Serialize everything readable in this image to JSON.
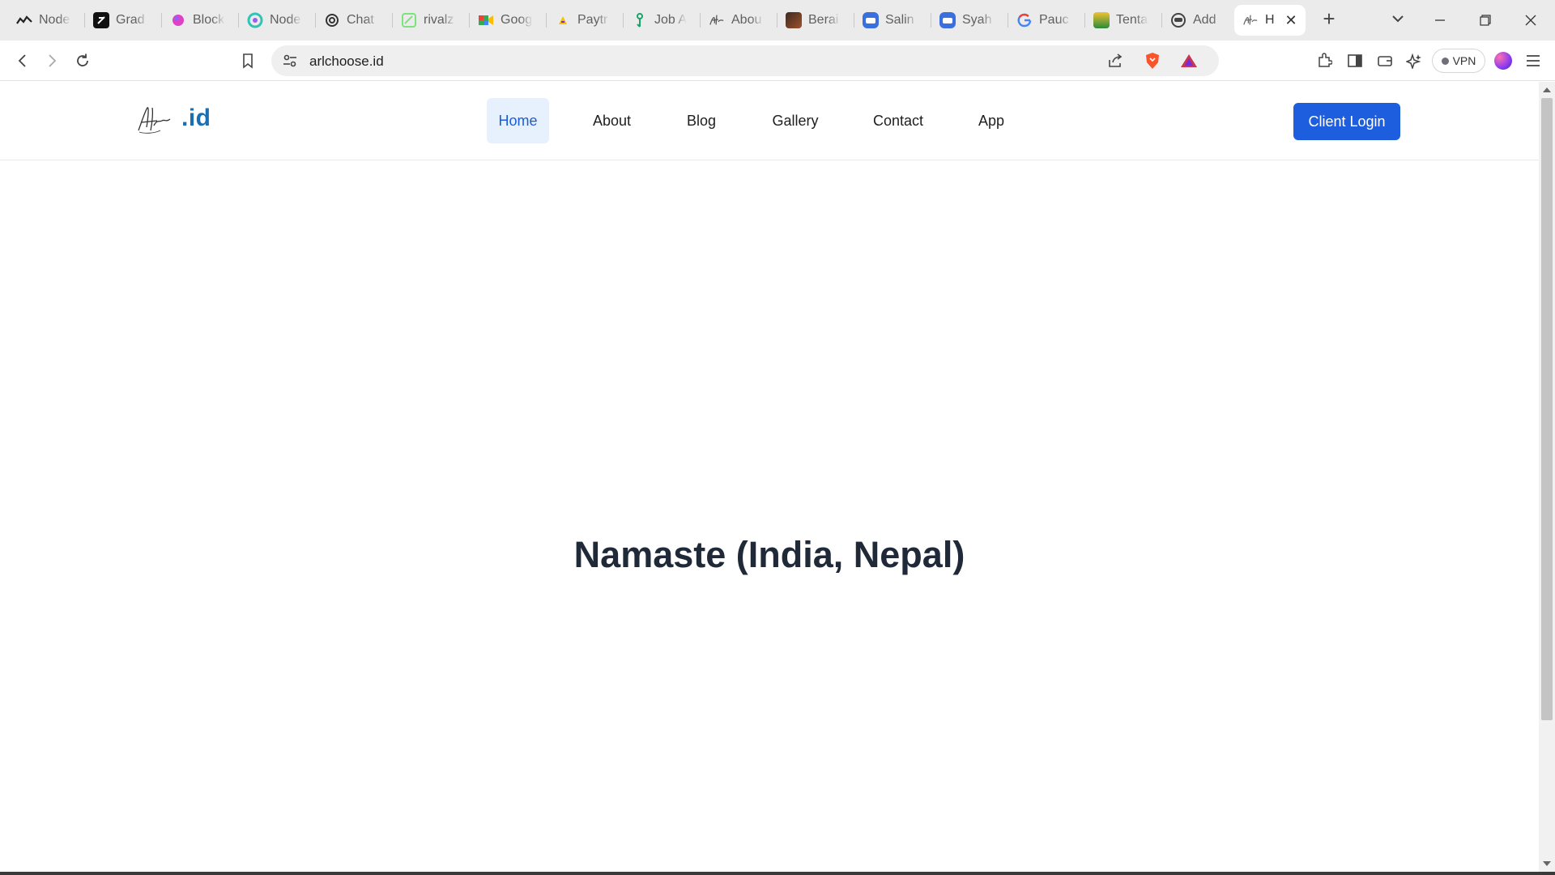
{
  "browser": {
    "tabs": [
      {
        "label": "Node",
        "icon": "node-icon",
        "color": "#222222"
      },
      {
        "label": "Grad",
        "icon": "grad-icon",
        "color": "#111111"
      },
      {
        "label": "Block",
        "icon": "block-icon",
        "color": "#e040c8"
      },
      {
        "label": "Node",
        "icon": "node-icon",
        "color": "#2ec4b6"
      },
      {
        "label": "Chat",
        "icon": "chatgpt-icon",
        "color": "#333333"
      },
      {
        "label": "rivalz",
        "icon": "rivalz-icon",
        "color": "#7be37b"
      },
      {
        "label": "Goog",
        "icon": "google-meet-icon",
        "color": "#fbbc04"
      },
      {
        "label": "Paytr",
        "icon": "paytr-icon",
        "color": "#f5c400"
      },
      {
        "label": "Job A",
        "icon": "job-icon",
        "color": "#1aa36b"
      },
      {
        "label": "Abou",
        "icon": "signature-icon",
        "color": "#555555"
      },
      {
        "label": "Berai",
        "icon": "berai-icon",
        "color": "#6b3d2a"
      },
      {
        "label": "Salin",
        "icon": "salin-icon",
        "color": "#3a6fe0"
      },
      {
        "label": "Syah",
        "icon": "syah-icon",
        "color": "#3a6fe0"
      },
      {
        "label": "Pauc",
        "icon": "google-icon",
        "color": "#4285f4"
      },
      {
        "label": "Tenta",
        "icon": "tenta-icon",
        "color": "#2a8a3a"
      },
      {
        "label": "Add",
        "icon": "add-icon",
        "color": "#444444"
      }
    ],
    "active_tab": {
      "label": "H",
      "icon": "signature-icon"
    },
    "url": "arlchoose.id",
    "vpn_label": "VPN"
  },
  "site": {
    "logo_text": ".id",
    "nav": [
      {
        "label": "Home",
        "active": true
      },
      {
        "label": "About",
        "active": false
      },
      {
        "label": "Blog",
        "active": false
      },
      {
        "label": "Gallery",
        "active": false
      },
      {
        "label": "Contact",
        "active": false
      },
      {
        "label": "App",
        "active": false
      }
    ],
    "login_label": "Client Login",
    "hero_title": "Namaste (India, Nepal)",
    "colors": {
      "primary": "#1d5ede",
      "logo": "#1a6fb3",
      "nav_active_bg": "#e6f1fd",
      "heading": "#1f2937"
    }
  }
}
